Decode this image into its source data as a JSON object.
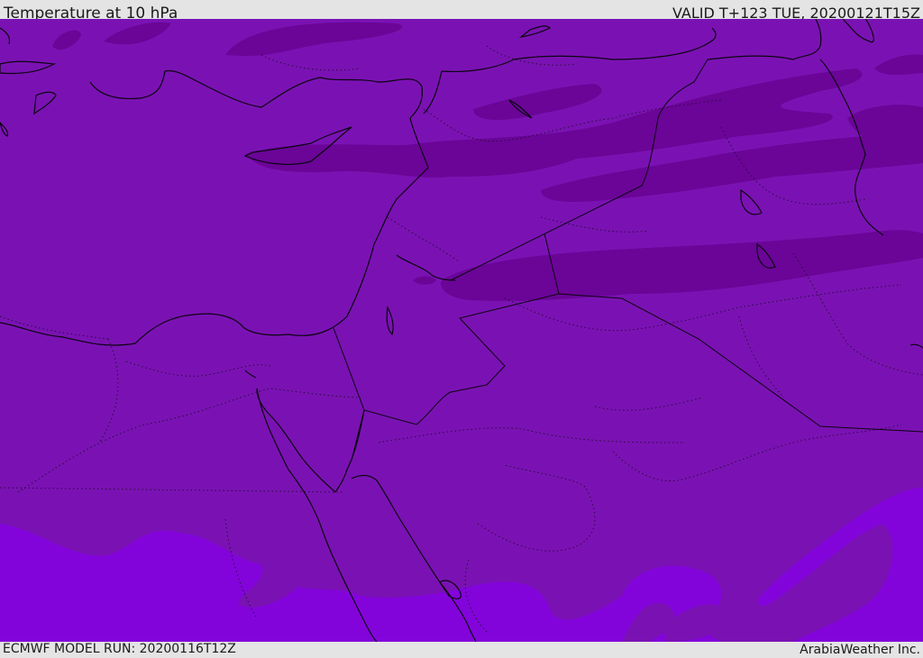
{
  "header": {
    "title": "Temperature at 10 hPa",
    "valid": "VALID T+123 TUE, 20200121T15Z"
  },
  "footer": {
    "model_run": "ECMWF MODEL RUN: 20200116T12Z",
    "credit": "ArabiaWeather Inc."
  },
  "map": {
    "colors": {
      "base": "#7a12b3",
      "darker_band": "#6a0597",
      "warmer_region": "#8204da",
      "coastline": "#0c0410",
      "border_dotted": "#2a0a3a"
    },
    "legend_shown": false
  }
}
